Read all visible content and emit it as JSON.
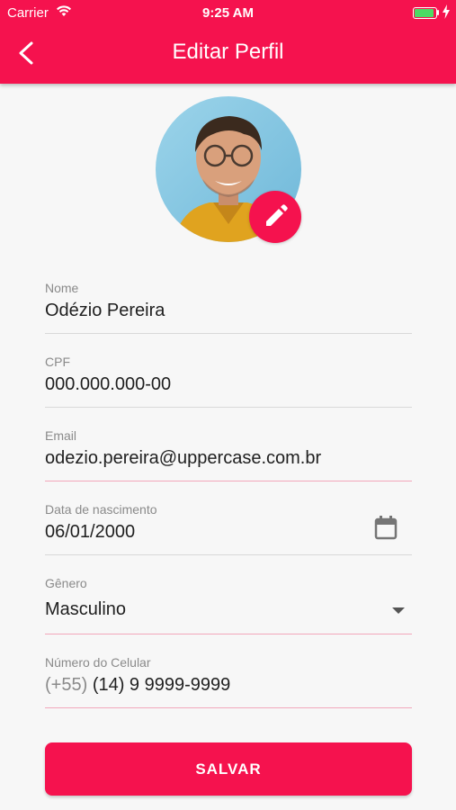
{
  "status_bar": {
    "carrier": "Carrier",
    "time": "9:25 AM"
  },
  "header": {
    "title": "Editar Perfil",
    "back_icon": "chevron-left-icon"
  },
  "profile": {
    "avatar": "avatar-photo",
    "edit_icon": "pencil-icon"
  },
  "form": {
    "nome": {
      "label": "Nome",
      "value": "Odézio Pereira"
    },
    "cpf": {
      "label": "CPF",
      "value": "000.000.000-00"
    },
    "email": {
      "label": "Email",
      "value": "odezio.pereira@uppercase.com.br"
    },
    "nascimento": {
      "label": "Data de nascimento",
      "value": "06/01/2000",
      "icon": "calendar-icon"
    },
    "genero": {
      "label": "Gênero",
      "value": "Masculino",
      "icon": "dropdown-arrow-icon"
    },
    "celular": {
      "label": "Número do Celular",
      "prefix": "(+55)",
      "value": "(14) 9 9999-9999"
    }
  },
  "actions": {
    "save_label": "SALVAR"
  },
  "colors": {
    "accent": "#f5124e",
    "background": "#f7f7f7",
    "text": "#1f1f1f",
    "label": "#8a8a8a"
  }
}
